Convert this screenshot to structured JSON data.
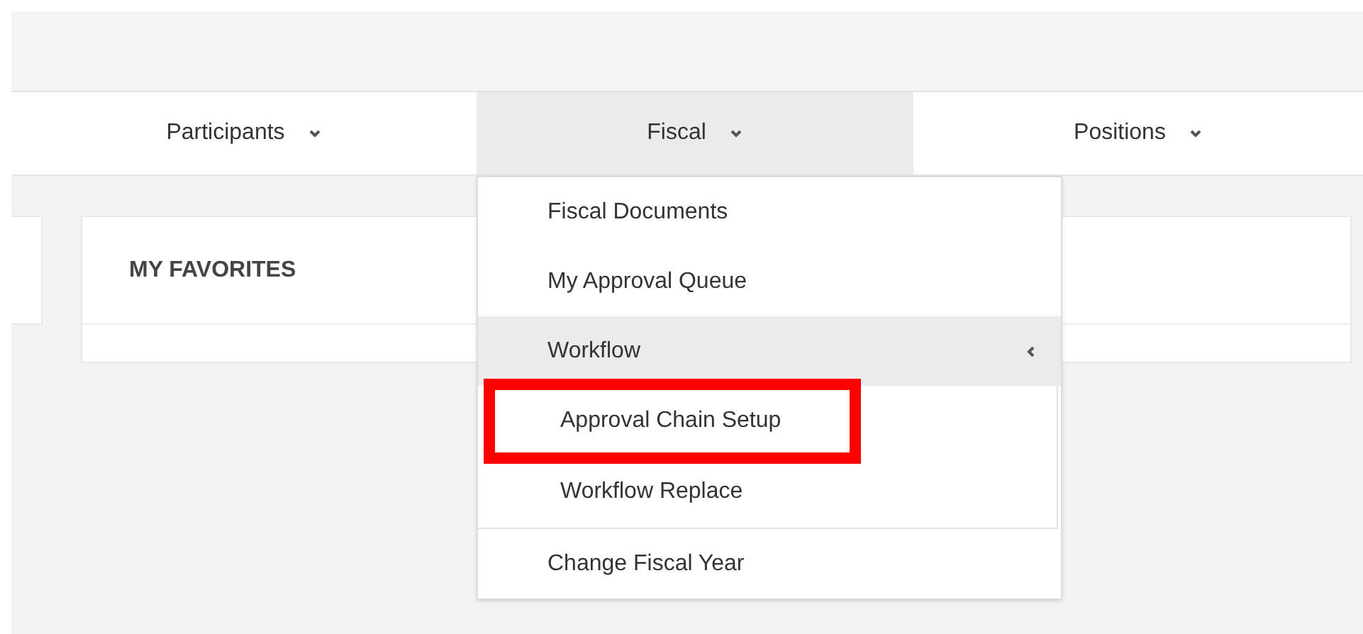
{
  "nav": {
    "tabs": [
      {
        "label": "Participants",
        "selected": false
      },
      {
        "label": "Fiscal",
        "selected": true
      },
      {
        "label": "Positions",
        "selected": false
      }
    ]
  },
  "dropdown": {
    "items": [
      {
        "label": "Fiscal Documents",
        "expanded": false
      },
      {
        "label": "My Approval Queue",
        "expanded": false
      },
      {
        "label": "Workflow",
        "expanded": true,
        "children": [
          {
            "label": "Approval Chain Setup",
            "highlighted": true
          },
          {
            "label": "Workflow Replace",
            "highlighted": false
          }
        ]
      },
      {
        "label": "Change Fiscal Year",
        "expanded": false
      }
    ]
  },
  "favorites": {
    "title": "MY FAVORITES"
  }
}
